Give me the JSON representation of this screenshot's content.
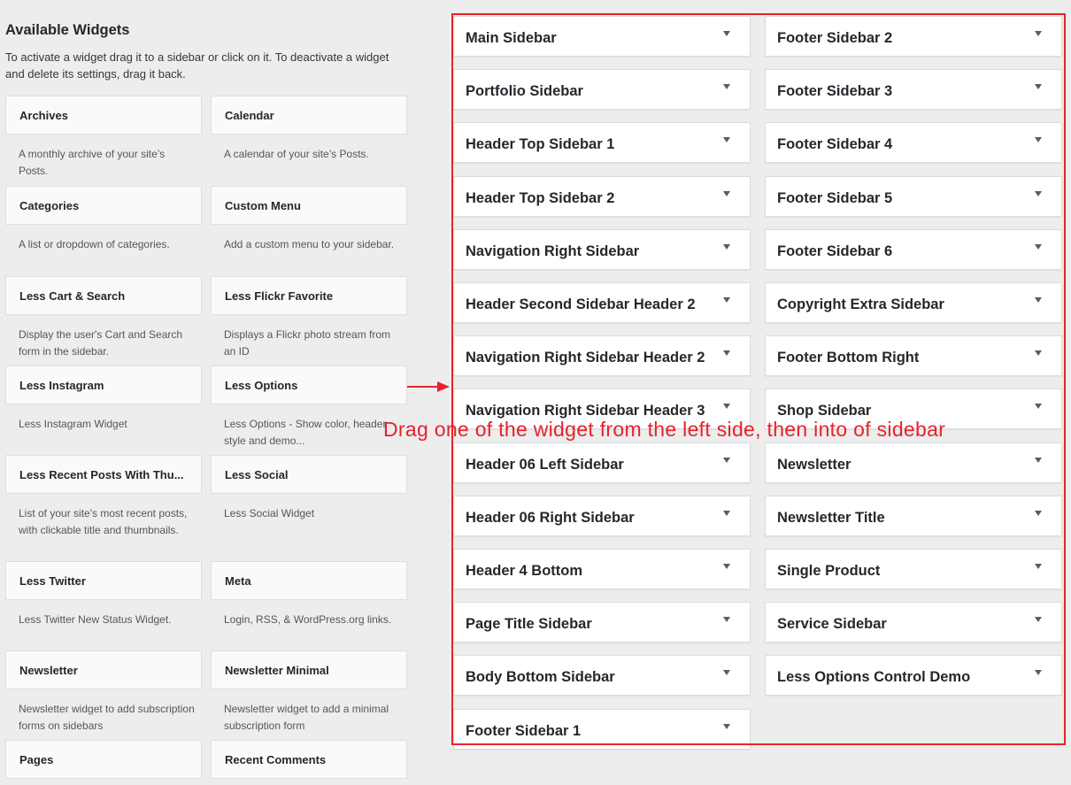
{
  "available": {
    "title": "Available Widgets",
    "description": "To activate a widget drag it to a sidebar or click on it. To deactivate a widget and delete its settings, drag it back."
  },
  "widgets": [
    {
      "name": "Archives",
      "desc": "A monthly archive of your site’s Posts."
    },
    {
      "name": "Calendar",
      "desc": "A calendar of your site’s Posts."
    },
    {
      "name": "Categories",
      "desc": "A list or dropdown of categories."
    },
    {
      "name": "Custom Menu",
      "desc": "Add a custom menu to your sidebar."
    },
    {
      "name": "Less Cart & Search",
      "desc": "Display the user's Cart and Search form in the sidebar."
    },
    {
      "name": "Less Flickr Favorite",
      "desc": "Displays a Flickr photo stream from an ID"
    },
    {
      "name": "Less Instagram",
      "desc": "Less Instagram Widget"
    },
    {
      "name": "Less Options",
      "desc": "Less Options - Show color, header style and demo..."
    },
    {
      "name": "Less Recent Posts With Thu...",
      "desc": "List of your site's most recent posts, with clickable title and thumbnails."
    },
    {
      "name": "Less Social",
      "desc": "Less Social Widget"
    },
    {
      "name": "Less Twitter",
      "desc": "Less Twitter New Status Widget."
    },
    {
      "name": "Meta",
      "desc": "Login, RSS, & WordPress.org links."
    },
    {
      "name": "Newsletter",
      "desc": "Newsletter widget to add subscription forms on sidebars"
    },
    {
      "name": "Newsletter Minimal",
      "desc": "Newsletter widget to add a minimal subscription form"
    },
    {
      "name": "Pages",
      "desc": ""
    },
    {
      "name": "Recent Comments",
      "desc": ""
    }
  ],
  "sidebars": {
    "left": [
      "Main Sidebar",
      "Portfolio Sidebar",
      "Header Top Sidebar 1",
      "Header Top Sidebar 2",
      "Navigation Right Sidebar",
      "Header Second Sidebar Header 2",
      "Navigation Right Sidebar Header 2",
      "Navigation Right Sidebar Header 3",
      "Header 06 Left Sidebar",
      "Header 06 Right Sidebar",
      "Header 4 Bottom",
      "Page Title Sidebar",
      "Body Bottom Sidebar",
      "Footer Sidebar 1"
    ],
    "right": [
      "Footer Sidebar 2",
      "Footer Sidebar 3",
      "Footer Sidebar 4",
      "Footer Sidebar 5",
      "Footer Sidebar 6",
      "Copyright Extra Sidebar",
      "Footer Bottom Right",
      "Shop Sidebar",
      "Newsletter",
      "Newsletter Title",
      "Single Product",
      "Service Sidebar",
      "Less Options Control Demo"
    ]
  },
  "annotation": {
    "text": "Drag one of the widget from the left side, then into of sidebar",
    "color": "#e5232b"
  },
  "colors": {
    "page_background": "#ededed",
    "highlight_red": "#e8232b"
  }
}
